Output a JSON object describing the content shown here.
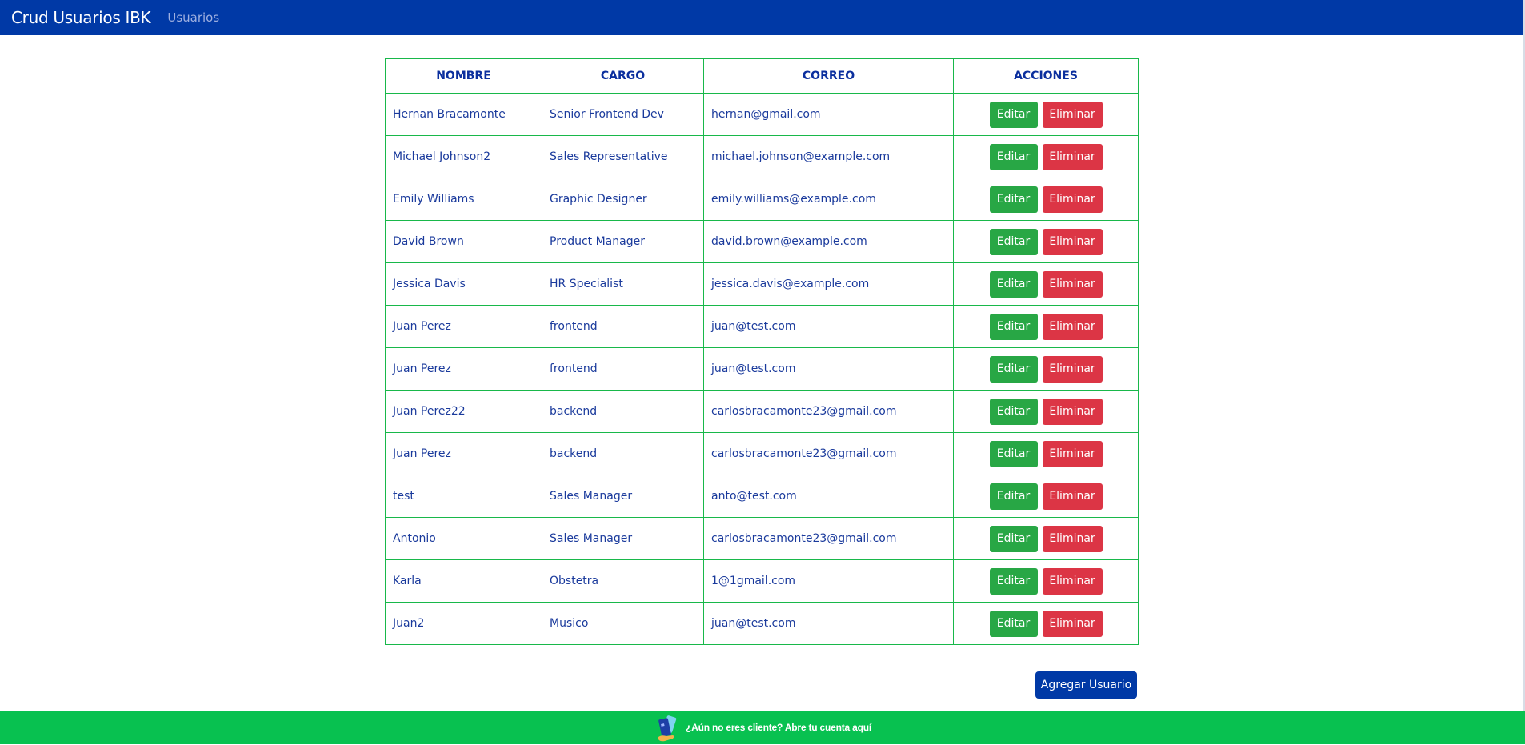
{
  "navbar": {
    "brand": "Crud Usuarios IBK",
    "link": "Usuarios"
  },
  "table": {
    "headers": [
      "NOMBRE",
      "CARGO",
      "CORREO",
      "ACCIONES"
    ],
    "rows": [
      {
        "nombre": "Hernan Bracamonte",
        "cargo": "Senior Frontend Dev",
        "correo": "hernan@gmail.com"
      },
      {
        "nombre": "Michael Johnson2",
        "cargo": "Sales Representative",
        "correo": "michael.johnson@example.com"
      },
      {
        "nombre": "Emily Williams",
        "cargo": "Graphic Designer",
        "correo": "emily.williams@example.com"
      },
      {
        "nombre": "David Brown",
        "cargo": "Product Manager",
        "correo": "david.brown@example.com"
      },
      {
        "nombre": "Jessica Davis",
        "cargo": "HR Specialist",
        "correo": "jessica.davis@example.com"
      },
      {
        "nombre": "Juan Perez",
        "cargo": "frontend",
        "correo": "juan@test.com"
      },
      {
        "nombre": "Juan Perez",
        "cargo": "frontend",
        "correo": "juan@test.com"
      },
      {
        "nombre": "Juan Perez22",
        "cargo": "backend",
        "correo": "carlosbracamonte23@gmail.com"
      },
      {
        "nombre": "Juan Perez",
        "cargo": "backend",
        "correo": "carlosbracamonte23@gmail.com"
      },
      {
        "nombre": "test",
        "cargo": "Sales Manager",
        "correo": "anto@test.com"
      },
      {
        "nombre": "Antonio",
        "cargo": "Sales Manager",
        "correo": "carlosbracamonte23@gmail.com"
      },
      {
        "nombre": "Karla",
        "cargo": "Obstetra",
        "correo": "1@1gmail.com"
      },
      {
        "nombre": "Juan2",
        "cargo": "Musico",
        "correo": "juan@test.com"
      }
    ],
    "edit_label": "Editar",
    "delete_label": "Eliminar"
  },
  "add_user_label": "Agregar Usuario",
  "footer": {
    "text": "¿Aún no eres cliente? Abre tu cuenta aquí",
    "icon": "cards-hand-icon"
  },
  "colors": {
    "navbar": "#0039a6",
    "table_border": "#18b84a",
    "edit": "#28a745",
    "delete": "#dc3545",
    "footer": "#08c150"
  }
}
